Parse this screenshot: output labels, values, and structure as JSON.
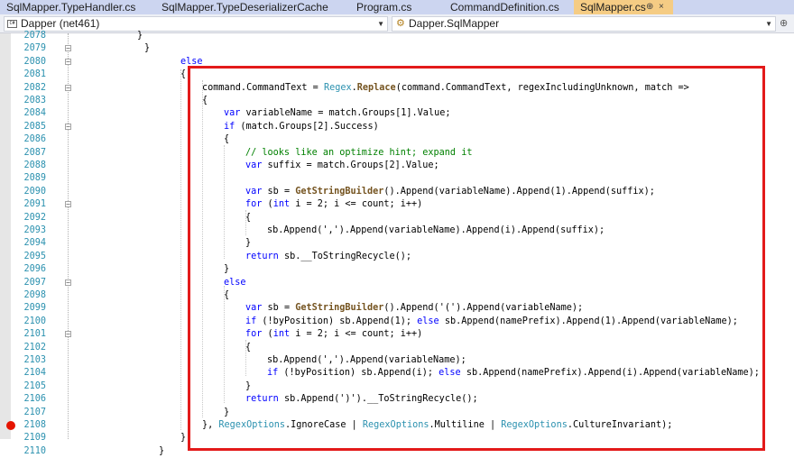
{
  "tabs": [
    {
      "label": "SqlMapper.TypeHandler.cs",
      "active": false
    },
    {
      "label": "SqlMapper.TypeDeserializerCache.cs",
      "active": false
    },
    {
      "label": "Program.cs",
      "active": false
    },
    {
      "label": "CommandDefinition.cs",
      "active": false
    },
    {
      "label": "SqlMapper.cs",
      "active": true,
      "pin": "⊕",
      "close": "×"
    }
  ],
  "navbar": {
    "project": "Dapper (net461)",
    "type": "Dapper.SqlMapper",
    "project_icon": "csharp-project-icon",
    "type_icon": "class-icon",
    "split_icon": "split-editor-icon"
  },
  "colors": {
    "highlight_border": "#e31a1a",
    "breakpoint": "#e51400",
    "active_tab": "#f5cc84",
    "line_number": "#2b91af"
  },
  "breakpoint_line": "2108",
  "lines": [
    {
      "n": "2078",
      "fold": "",
      "tokens": [
        {
          "t": "}",
          "c": "p"
        }
      ]
    },
    {
      "n": "2079",
      "fold": "-",
      "tokens": [
        {
          "t": "}",
          "c": "p"
        }
      ]
    },
    {
      "n": "2080",
      "fold": "-",
      "tokens": [
        {
          "t": "else",
          "c": "kw"
        }
      ]
    },
    {
      "n": "2081",
      "fold": "",
      "tokens": [
        {
          "t": "{",
          "c": "p"
        }
      ]
    },
    {
      "n": "2082",
      "fold": "-",
      "tokens": [
        {
          "t": "command.CommandText = ",
          "c": "p"
        },
        {
          "t": "Regex",
          "c": "ty"
        },
        {
          "t": ".",
          "c": "p"
        },
        {
          "t": "Replace",
          "c": "m"
        },
        {
          "t": "(command.CommandText, regexIncludingUnknown, match =>",
          "c": "p"
        }
      ]
    },
    {
      "n": "2083",
      "fold": "",
      "tokens": [
        {
          "t": "{",
          "c": "p"
        }
      ]
    },
    {
      "n": "2084",
      "fold": "",
      "tokens": [
        {
          "t": "var",
          "c": "kw"
        },
        {
          "t": " variableName = match.Groups[1].Value;",
          "c": "p"
        }
      ]
    },
    {
      "n": "2085",
      "fold": "-",
      "tokens": [
        {
          "t": "if",
          "c": "kw"
        },
        {
          "t": " (match.Groups[2].Success)",
          "c": "p"
        }
      ]
    },
    {
      "n": "2086",
      "fold": "",
      "tokens": [
        {
          "t": "{",
          "c": "p"
        }
      ]
    },
    {
      "n": "2087",
      "fold": "",
      "tokens": [
        {
          "t": "// looks like an optimize hint; expand it",
          "c": "cm"
        }
      ]
    },
    {
      "n": "2088",
      "fold": "",
      "tokens": [
        {
          "t": "var",
          "c": "kw"
        },
        {
          "t": " suffix = match.Groups[2].Value;",
          "c": "p"
        }
      ]
    },
    {
      "n": "2089",
      "fold": "",
      "tokens": []
    },
    {
      "n": "2090",
      "fold": "",
      "tokens": [
        {
          "t": "var",
          "c": "kw"
        },
        {
          "t": " sb = ",
          "c": "p"
        },
        {
          "t": "GetStringBuilder",
          "c": "m"
        },
        {
          "t": "().Append(variableName).Append(1).Append(suffix);",
          "c": "p"
        }
      ]
    },
    {
      "n": "2091",
      "fold": "-",
      "tokens": [
        {
          "t": "for",
          "c": "kw"
        },
        {
          "t": " (",
          "c": "p"
        },
        {
          "t": "int",
          "c": "kw"
        },
        {
          "t": " i = 2; i <= count; i++)",
          "c": "p"
        }
      ]
    },
    {
      "n": "2092",
      "fold": "",
      "tokens": [
        {
          "t": "{",
          "c": "p"
        }
      ]
    },
    {
      "n": "2093",
      "fold": "",
      "tokens": [
        {
          "t": "sb.Append(',').Append(variableName).Append(i).Append(suffix);",
          "c": "p"
        }
      ]
    },
    {
      "n": "2094",
      "fold": "",
      "tokens": [
        {
          "t": "}",
          "c": "p"
        }
      ]
    },
    {
      "n": "2095",
      "fold": "",
      "tokens": [
        {
          "t": "return",
          "c": "kw"
        },
        {
          "t": " sb.__ToStringRecycle();",
          "c": "p"
        }
      ]
    },
    {
      "n": "2096",
      "fold": "",
      "tokens": [
        {
          "t": "}",
          "c": "p"
        }
      ]
    },
    {
      "n": "2097",
      "fold": "-",
      "tokens": [
        {
          "t": "else",
          "c": "kw"
        }
      ]
    },
    {
      "n": "2098",
      "fold": "",
      "tokens": [
        {
          "t": "{",
          "c": "p"
        }
      ]
    },
    {
      "n": "2099",
      "fold": "",
      "tokens": [
        {
          "t": "var",
          "c": "kw"
        },
        {
          "t": " sb = ",
          "c": "p"
        },
        {
          "t": "GetStringBuilder",
          "c": "m"
        },
        {
          "t": "().Append('(').Append(variableName);",
          "c": "p"
        }
      ]
    },
    {
      "n": "2100",
      "fold": "",
      "tokens": [
        {
          "t": "if",
          "c": "kw"
        },
        {
          "t": " (!byPosition) sb.Append(1); ",
          "c": "p"
        },
        {
          "t": "else",
          "c": "kw"
        },
        {
          "t": " sb.Append(namePrefix).Append(1).Append(variableName);",
          "c": "p"
        }
      ]
    },
    {
      "n": "2101",
      "fold": "-",
      "tokens": [
        {
          "t": "for",
          "c": "kw"
        },
        {
          "t": " (",
          "c": "p"
        },
        {
          "t": "int",
          "c": "kw"
        },
        {
          "t": " i = 2; i <= count; i++)",
          "c": "p"
        }
      ]
    },
    {
      "n": "2102",
      "fold": "",
      "tokens": [
        {
          "t": "{",
          "c": "p"
        }
      ]
    },
    {
      "n": "2103",
      "fold": "",
      "tokens": [
        {
          "t": "sb.Append(',').Append(variableName);",
          "c": "p"
        }
      ]
    },
    {
      "n": "2104",
      "fold": "",
      "tokens": [
        {
          "t": "if",
          "c": "kw"
        },
        {
          "t": " (!byPosition) sb.Append(i); ",
          "c": "p"
        },
        {
          "t": "else",
          "c": "kw"
        },
        {
          "t": " sb.Append(namePrefix).Append(i).Append(variableName);",
          "c": "p"
        }
      ]
    },
    {
      "n": "2105",
      "fold": "",
      "tokens": [
        {
          "t": "}",
          "c": "p"
        }
      ]
    },
    {
      "n": "2106",
      "fold": "",
      "tokens": [
        {
          "t": "return",
          "c": "kw"
        },
        {
          "t": " sb.Append(')').__ToStringRecycle();",
          "c": "p"
        }
      ]
    },
    {
      "n": "2107",
      "fold": "",
      "tokens": [
        {
          "t": "}",
          "c": "p"
        }
      ]
    },
    {
      "n": "2108",
      "fold": "",
      "tokens": [
        {
          "t": "}, ",
          "c": "p"
        },
        {
          "t": "RegexOptions",
          "c": "ty"
        },
        {
          "t": ".IgnoreCase | ",
          "c": "p"
        },
        {
          "t": "RegexOptions",
          "c": "ty"
        },
        {
          "t": ".Multiline | ",
          "c": "p"
        },
        {
          "t": "RegexOptions",
          "c": "ty"
        },
        {
          "t": ".CultureInvariant);",
          "c": "p"
        }
      ]
    },
    {
      "n": "2109",
      "fold": "",
      "tokens": [
        {
          "t": "}",
          "c": "p"
        }
      ]
    },
    {
      "n": "2110",
      "fold": "",
      "tokens": [
        {
          "t": "}",
          "c": "p"
        }
      ]
    }
  ]
}
